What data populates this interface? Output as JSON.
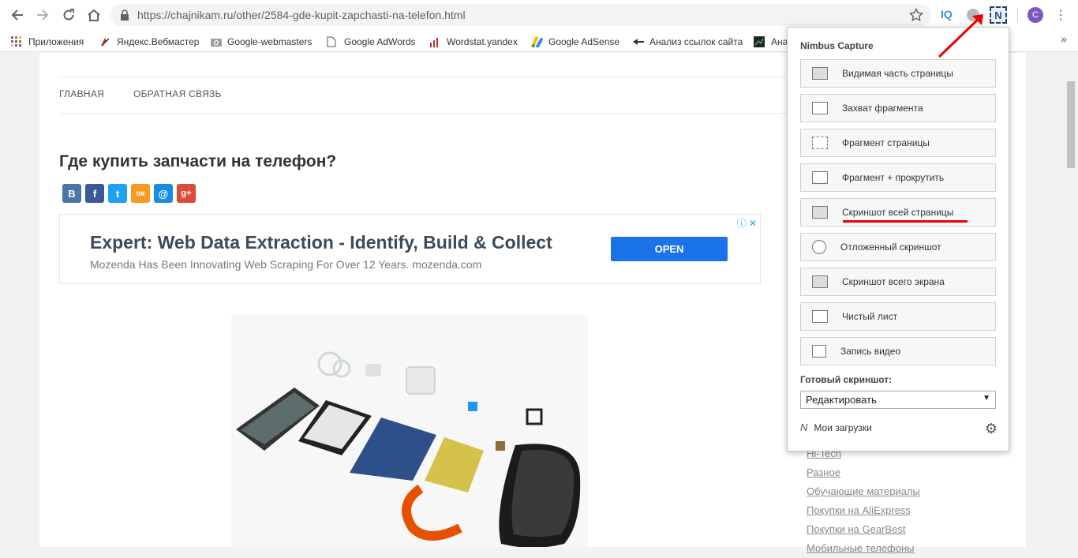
{
  "browser": {
    "url": "https://chajnikam.ru/other/2584-gde-kupit-zapchasti-na-telefon.html",
    "extensions": {
      "iq_label": "IQ",
      "nimbus_label": "N",
      "avatar_letter": "C"
    }
  },
  "bookmarks": [
    {
      "label": "Приложения",
      "icon": "apps-grid-icon"
    },
    {
      "label": "Яндекс.Вебмастер",
      "icon": "webmaster-icon"
    },
    {
      "label": "Google-webmasters",
      "icon": "gwt-icon"
    },
    {
      "label": "Google AdWords",
      "icon": "page-icon"
    },
    {
      "label": "Wordstat.yandex",
      "icon": "bar-icon"
    },
    {
      "label": "Google AdSense",
      "icon": "adsense-icon"
    },
    {
      "label": "Анализ ссылок сайта",
      "icon": "arrow-icon"
    },
    {
      "label": "Ана",
      "icon": "chart-icon"
    }
  ],
  "bookmarks_more": "»",
  "site": {
    "menu": [
      "ГЛАВНАЯ",
      "ОБРАТНАЯ СВЯЗЬ"
    ],
    "title": "Где купить запчасти на телефон?",
    "share": [
      "В",
      "f",
      "t",
      "ок",
      "@",
      "g+"
    ]
  },
  "ad": {
    "headline": "Expert: Web Data Extraction - Identify, Build & Collect",
    "description": "Mozenda Has Been Innovating Web Scraping For Over 12 Years. mozenda.com",
    "button": "OPEN",
    "choice": "ⓘ ✕"
  },
  "sidebar_links": [
    "Hi-Tech",
    "Разное",
    "Обучающие материалы",
    "Покупки на AliExpress",
    "Покупки на GearBest",
    "Мобильные телефоны"
  ],
  "popup": {
    "title": "Nimbus Capture",
    "buttons": [
      "Видимая часть страницы",
      "Захват фрагмента",
      "Фрагмент страницы",
      "Фрагмент + прокрутить",
      "Скриншот всей страницы",
      "Отложенный скриншот",
      "Скриншот всего экрана",
      "Чистый лист",
      "Запись видео"
    ],
    "ready_label": "Готовый скриншот:",
    "ready_value": "Редактировать",
    "downloads": "Мои загрузки"
  },
  "colors": {
    "accent": "#1a73e8",
    "highlight": "#e00000"
  }
}
